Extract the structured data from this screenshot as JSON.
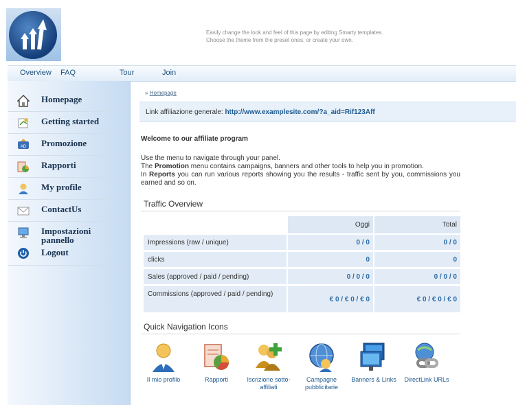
{
  "header": {
    "line1": "Easily change the look and feel of this page by editing Smarty templates.",
    "line2": "Choose the theme from the preset ones, or create your own."
  },
  "topnav": [
    "Overview",
    "FAQ",
    "Tour",
    "Join"
  ],
  "sidebar": {
    "items": [
      {
        "label": "Homepage",
        "icon": "home-icon"
      },
      {
        "label": "Getting started",
        "icon": "document-icon"
      },
      {
        "label": "Promozione",
        "icon": "ad-icon"
      },
      {
        "label": "Rapporti",
        "icon": "report-icon"
      },
      {
        "label": "My profile",
        "icon": "user-icon"
      },
      {
        "label": "ContactUs",
        "icon": "envelope-icon"
      },
      {
        "label": "Impostazioni pannello",
        "icon": "monitor-icon"
      },
      {
        "label": "Logout",
        "icon": "power-icon"
      }
    ]
  },
  "breadcrumb": {
    "prefix": "»",
    "link": "Homepage"
  },
  "affiliate_link": {
    "label": "Link affiliazione generale:",
    "url": "http://www.examplesite.com/?a_aid=Rif123Aff"
  },
  "welcome": "Welcome to our affiliate program",
  "intro": {
    "line1": "Use the menu to navigate through your panel.",
    "l2_pre": "The ",
    "l2_bold": "Promotion",
    "l2_post": " menu contains campaigns, banners and other tools to help you in promotion.",
    "l3_pre": "In ",
    "l3_bold": "Reports",
    "l3_post": " you can run various reports showing you the results - traffic sent by you, commissions you earned and so on."
  },
  "traffic": {
    "title": "Traffic Overview",
    "col_today": "Oggi",
    "col_total": "Total",
    "rows": [
      {
        "label": "Impressions (raw / unique)",
        "today": "0 / 0",
        "total": "0 / 0"
      },
      {
        "label": "clicks",
        "today": "0",
        "total": "0"
      },
      {
        "label": "Sales (approved / paid / pending)",
        "today": "0 / 0 / 0",
        "total": "0 / 0 / 0"
      },
      {
        "label": "Commissions (approved / paid / pending)",
        "today": "€ 0 / € 0 / € 0",
        "total": "€ 0 / € 0 / € 0"
      }
    ]
  },
  "quick_nav": {
    "title": "Quick Navigation Icons",
    "items": [
      {
        "label": "Il mio profilo",
        "icon": "profile-icon"
      },
      {
        "label": "Rapporti",
        "icon": "reports-icon"
      },
      {
        "label": "Iscrizione sotto-affiliati",
        "icon": "subaffiliate-icon"
      },
      {
        "label": "Campagne pubblicitarie",
        "icon": "campaign-icon"
      },
      {
        "label": "Banners & Links",
        "icon": "banner-icon"
      },
      {
        "label": "DirectLink URLs",
        "icon": "directlink-icon"
      }
    ]
  }
}
